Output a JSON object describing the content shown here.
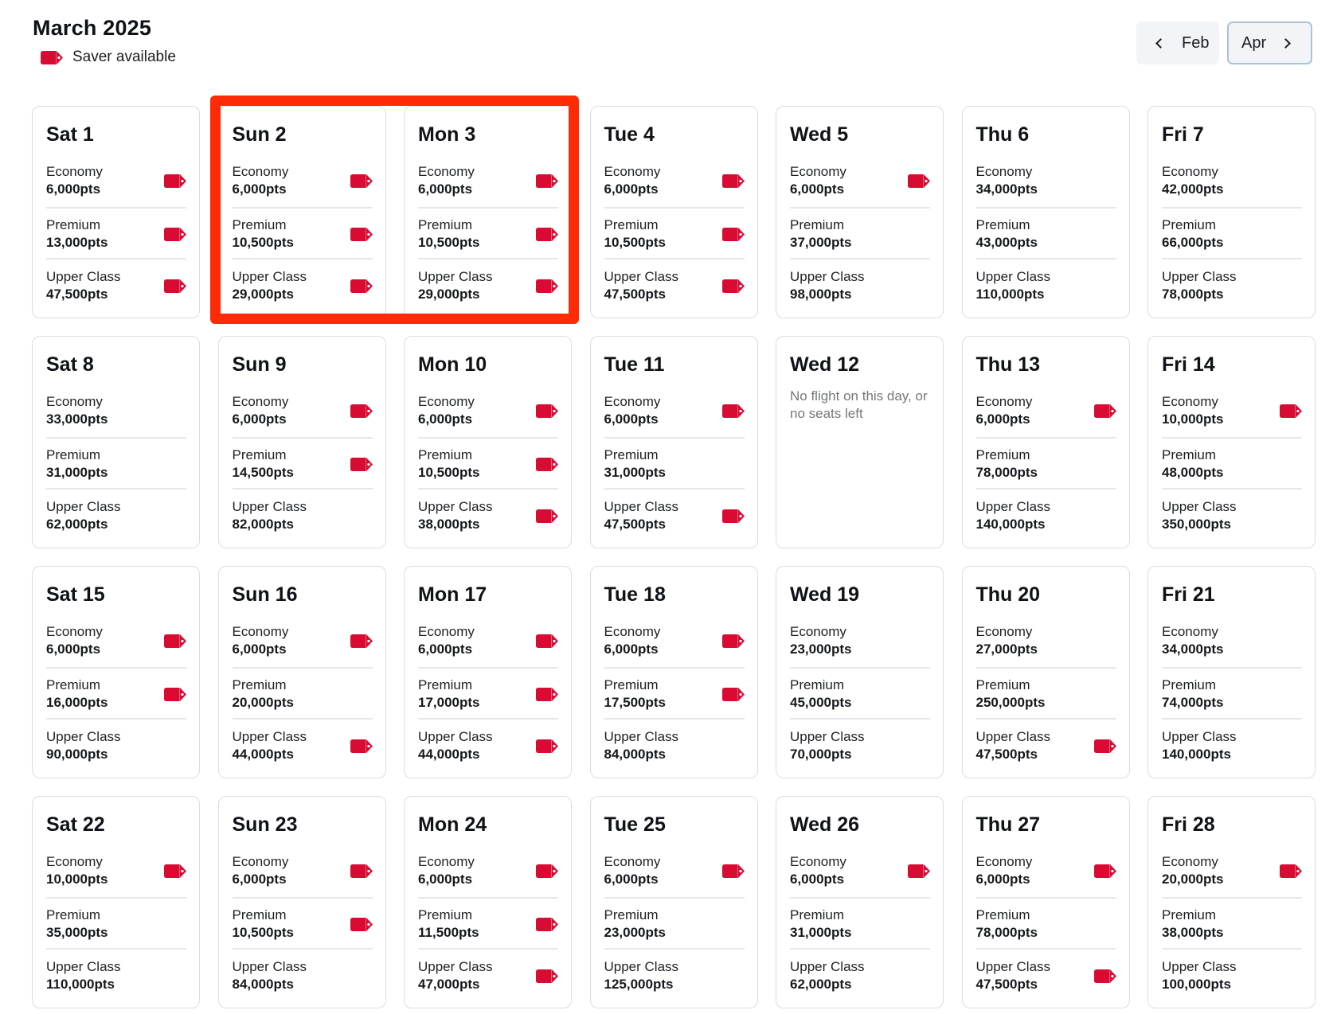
{
  "header": {
    "title": "March 2025",
    "legend_label": "Saver available",
    "legend_icon": "saver-tag-icon"
  },
  "nav": {
    "prev_label": "Feb",
    "next_label": "Apr"
  },
  "colors": {
    "saver_tag": "#d90b33",
    "highlight": "#ff2a06"
  },
  "highlight": {
    "days": [
      "Sun 2",
      "Mon 3"
    ]
  },
  "days": [
    {
      "label": "Sat 1",
      "fares": [
        {
          "cabin": "Economy",
          "price": "6,000pts",
          "saver": true
        },
        {
          "cabin": "Premium",
          "price": "13,000pts",
          "saver": true
        },
        {
          "cabin": "Upper Class",
          "price": "47,500pts",
          "saver": true
        }
      ]
    },
    {
      "label": "Sun 2",
      "fares": [
        {
          "cabin": "Economy",
          "price": "6,000pts",
          "saver": true
        },
        {
          "cabin": "Premium",
          "price": "10,500pts",
          "saver": true
        },
        {
          "cabin": "Upper Class",
          "price": "29,000pts",
          "saver": true
        }
      ]
    },
    {
      "label": "Mon 3",
      "fares": [
        {
          "cabin": "Economy",
          "price": "6,000pts",
          "saver": true
        },
        {
          "cabin": "Premium",
          "price": "10,500pts",
          "saver": true
        },
        {
          "cabin": "Upper Class",
          "price": "29,000pts",
          "saver": true
        }
      ]
    },
    {
      "label": "Tue 4",
      "fares": [
        {
          "cabin": "Economy",
          "price": "6,000pts",
          "saver": true
        },
        {
          "cabin": "Premium",
          "price": "10,500pts",
          "saver": true
        },
        {
          "cabin": "Upper Class",
          "price": "47,500pts",
          "saver": true
        }
      ]
    },
    {
      "label": "Wed 5",
      "fares": [
        {
          "cabin": "Economy",
          "price": "6,000pts",
          "saver": true
        },
        {
          "cabin": "Premium",
          "price": "37,000pts",
          "saver": false
        },
        {
          "cabin": "Upper Class",
          "price": "98,000pts",
          "saver": false
        }
      ]
    },
    {
      "label": "Thu 6",
      "fares": [
        {
          "cabin": "Economy",
          "price": "34,000pts",
          "saver": false
        },
        {
          "cabin": "Premium",
          "price": "43,000pts",
          "saver": false
        },
        {
          "cabin": "Upper Class",
          "price": "110,000pts",
          "saver": false
        }
      ]
    },
    {
      "label": "Fri 7",
      "fares": [
        {
          "cabin": "Economy",
          "price": "42,000pts",
          "saver": false
        },
        {
          "cabin": "Premium",
          "price": "66,000pts",
          "saver": false
        },
        {
          "cabin": "Upper Class",
          "price": "78,000pts",
          "saver": false
        }
      ]
    },
    {
      "label": "Sat 8",
      "fares": [
        {
          "cabin": "Economy",
          "price": "33,000pts",
          "saver": false
        },
        {
          "cabin": "Premium",
          "price": "31,000pts",
          "saver": false
        },
        {
          "cabin": "Upper Class",
          "price": "62,000pts",
          "saver": false
        }
      ]
    },
    {
      "label": "Sun 9",
      "fares": [
        {
          "cabin": "Economy",
          "price": "6,000pts",
          "saver": true
        },
        {
          "cabin": "Premium",
          "price": "14,500pts",
          "saver": true
        },
        {
          "cabin": "Upper Class",
          "price": "82,000pts",
          "saver": false
        }
      ]
    },
    {
      "label": "Mon 10",
      "fares": [
        {
          "cabin": "Economy",
          "price": "6,000pts",
          "saver": true
        },
        {
          "cabin": "Premium",
          "price": "10,500pts",
          "saver": true
        },
        {
          "cabin": "Upper Class",
          "price": "38,000pts",
          "saver": true
        }
      ]
    },
    {
      "label": "Tue 11",
      "fares": [
        {
          "cabin": "Economy",
          "price": "6,000pts",
          "saver": true
        },
        {
          "cabin": "Premium",
          "price": "31,000pts",
          "saver": false
        },
        {
          "cabin": "Upper Class",
          "price": "47,500pts",
          "saver": true
        }
      ]
    },
    {
      "label": "Wed 12",
      "fares": [],
      "message": "No flight on this day, or no seats left"
    },
    {
      "label": "Thu 13",
      "fares": [
        {
          "cabin": "Economy",
          "price": "6,000pts",
          "saver": true
        },
        {
          "cabin": "Premium",
          "price": "78,000pts",
          "saver": false
        },
        {
          "cabin": "Upper Class",
          "price": "140,000pts",
          "saver": false
        }
      ]
    },
    {
      "label": "Fri 14",
      "fares": [
        {
          "cabin": "Economy",
          "price": "10,000pts",
          "saver": true
        },
        {
          "cabin": "Premium",
          "price": "48,000pts",
          "saver": false
        },
        {
          "cabin": "Upper Class",
          "price": "350,000pts",
          "saver": false
        }
      ]
    },
    {
      "label": "Sat 15",
      "fares": [
        {
          "cabin": "Economy",
          "price": "6,000pts",
          "saver": true
        },
        {
          "cabin": "Premium",
          "price": "16,000pts",
          "saver": true
        },
        {
          "cabin": "Upper Class",
          "price": "90,000pts",
          "saver": false
        }
      ]
    },
    {
      "label": "Sun 16",
      "fares": [
        {
          "cabin": "Economy",
          "price": "6,000pts",
          "saver": true
        },
        {
          "cabin": "Premium",
          "price": "20,000pts",
          "saver": false
        },
        {
          "cabin": "Upper Class",
          "price": "44,000pts",
          "saver": true
        }
      ]
    },
    {
      "label": "Mon 17",
      "fares": [
        {
          "cabin": "Economy",
          "price": "6,000pts",
          "saver": true
        },
        {
          "cabin": "Premium",
          "price": "17,000pts",
          "saver": true
        },
        {
          "cabin": "Upper Class",
          "price": "44,000pts",
          "saver": true
        }
      ]
    },
    {
      "label": "Tue 18",
      "fares": [
        {
          "cabin": "Economy",
          "price": "6,000pts",
          "saver": true
        },
        {
          "cabin": "Premium",
          "price": "17,500pts",
          "saver": true
        },
        {
          "cabin": "Upper Class",
          "price": "84,000pts",
          "saver": false
        }
      ]
    },
    {
      "label": "Wed 19",
      "fares": [
        {
          "cabin": "Economy",
          "price": "23,000pts",
          "saver": false
        },
        {
          "cabin": "Premium",
          "price": "45,000pts",
          "saver": false
        },
        {
          "cabin": "Upper Class",
          "price": "70,000pts",
          "saver": false
        }
      ]
    },
    {
      "label": "Thu 20",
      "fares": [
        {
          "cabin": "Economy",
          "price": "27,000pts",
          "saver": false
        },
        {
          "cabin": "Premium",
          "price": "250,000pts",
          "saver": false
        },
        {
          "cabin": "Upper Class",
          "price": "47,500pts",
          "saver": true
        }
      ]
    },
    {
      "label": "Fri 21",
      "fares": [
        {
          "cabin": "Economy",
          "price": "34,000pts",
          "saver": false
        },
        {
          "cabin": "Premium",
          "price": "74,000pts",
          "saver": false
        },
        {
          "cabin": "Upper Class",
          "price": "140,000pts",
          "saver": false
        }
      ]
    },
    {
      "label": "Sat 22",
      "fares": [
        {
          "cabin": "Economy",
          "price": "10,000pts",
          "saver": true
        },
        {
          "cabin": "Premium",
          "price": "35,000pts",
          "saver": false
        },
        {
          "cabin": "Upper Class",
          "price": "110,000pts",
          "saver": false
        }
      ]
    },
    {
      "label": "Sun 23",
      "fares": [
        {
          "cabin": "Economy",
          "price": "6,000pts",
          "saver": true
        },
        {
          "cabin": "Premium",
          "price": "10,500pts",
          "saver": true
        },
        {
          "cabin": "Upper Class",
          "price": "84,000pts",
          "saver": false
        }
      ]
    },
    {
      "label": "Mon 24",
      "fares": [
        {
          "cabin": "Economy",
          "price": "6,000pts",
          "saver": true
        },
        {
          "cabin": "Premium",
          "price": "11,500pts",
          "saver": true
        },
        {
          "cabin": "Upper Class",
          "price": "47,000pts",
          "saver": true
        }
      ]
    },
    {
      "label": "Tue 25",
      "fares": [
        {
          "cabin": "Economy",
          "price": "6,000pts",
          "saver": true
        },
        {
          "cabin": "Premium",
          "price": "23,000pts",
          "saver": false
        },
        {
          "cabin": "Upper Class",
          "price": "125,000pts",
          "saver": false
        }
      ]
    },
    {
      "label": "Wed 26",
      "fares": [
        {
          "cabin": "Economy",
          "price": "6,000pts",
          "saver": true
        },
        {
          "cabin": "Premium",
          "price": "31,000pts",
          "saver": false
        },
        {
          "cabin": "Upper Class",
          "price": "62,000pts",
          "saver": false
        }
      ]
    },
    {
      "label": "Thu 27",
      "fares": [
        {
          "cabin": "Economy",
          "price": "6,000pts",
          "saver": true
        },
        {
          "cabin": "Premium",
          "price": "78,000pts",
          "saver": false
        },
        {
          "cabin": "Upper Class",
          "price": "47,500pts",
          "saver": true
        }
      ]
    },
    {
      "label": "Fri 28",
      "fares": [
        {
          "cabin": "Economy",
          "price": "20,000pts",
          "saver": true
        },
        {
          "cabin": "Premium",
          "price": "38,000pts",
          "saver": false
        },
        {
          "cabin": "Upper Class",
          "price": "100,000pts",
          "saver": false
        }
      ]
    }
  ]
}
